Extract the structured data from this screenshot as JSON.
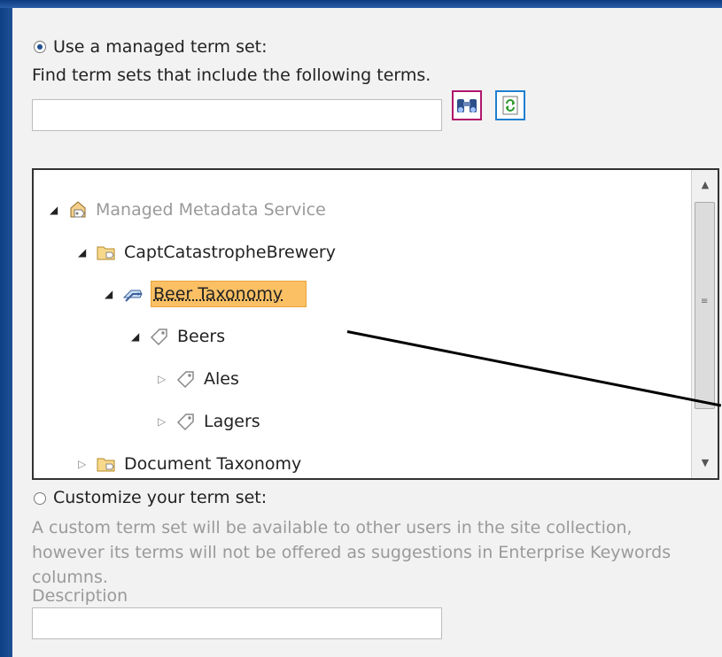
{
  "managed": {
    "radio_label": "Use a managed term set:",
    "find_hint": "Find term sets that include the following terms.",
    "search_value": "",
    "search_icon": "binoculars-icon",
    "refresh_icon": "refresh-icon"
  },
  "tree": {
    "nodes": [
      {
        "label": "Managed Metadata Service",
        "icon": "metadata-service-icon",
        "state": "expanded"
      },
      {
        "label": "CaptCatastropheBrewery",
        "icon": "folder-icon",
        "state": "expanded"
      },
      {
        "label": "Beer Taxonomy",
        "icon": "termset-icon",
        "state": "expanded",
        "selected": true
      },
      {
        "label": "Beers",
        "icon": "tag-icon",
        "state": "expanded"
      },
      {
        "label": "Ales",
        "icon": "tag-icon",
        "state": "collapsed"
      },
      {
        "label": "Lagers",
        "icon": "tag-icon",
        "state": "collapsed"
      },
      {
        "label": "Document Taxonomy",
        "icon": "folder-icon",
        "state": "collapsed"
      }
    ]
  },
  "custom": {
    "radio_label": "Customize your term set:",
    "description_text": "A custom term set will be available to other users in the site collection, however its terms will not be offered as suggestions in Enterprise Keywords columns.",
    "description_label": "Description",
    "description_value": ""
  },
  "colors": {
    "frame_blue": "#1d4f95",
    "selection": "#fbc064",
    "binoculars_border": "#b0166b",
    "refresh_border": "#1e7fcf"
  }
}
